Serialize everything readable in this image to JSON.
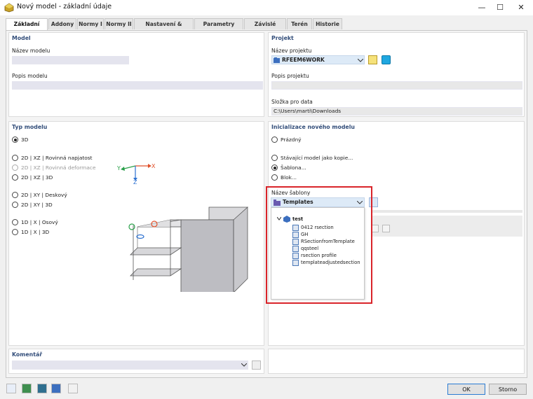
{
  "window": {
    "title": "Nový model - základní údaje",
    "minimize": "—",
    "maximize": "☐",
    "close": "✕"
  },
  "tabs": [
    "Základní údaje",
    "Addony",
    "Normy I",
    "Normy II",
    "Nastavení & možnosti",
    "Parametry modelu",
    "Závislé modely",
    "Terén",
    "Historie"
  ],
  "model": {
    "section": "Model",
    "name_label": "Název modelu",
    "name_value": "",
    "desc_label": "Popis modelu",
    "desc_value": ""
  },
  "project": {
    "section": "Projekt",
    "name_label": "Název projektu",
    "name_value": "RFEEM6WORK",
    "desc_label": "Popis projektu",
    "desc_value": "",
    "folder_label": "Složka pro data",
    "folder_value": "C:\\Users\\marti\\Downloads"
  },
  "model_type": {
    "section": "Typ modelu",
    "options": [
      "3D",
      "2D | XZ | Rovinná napjatost",
      "2D | XZ | Rovinná deformace",
      "2D | XZ | 3D",
      "2D | XY | Deskový",
      "2D | XY | 3D",
      "1D | X | Osový",
      "1D | X | 3D"
    ],
    "selected": "3D",
    "disabled": [
      "2D | XZ | Rovinná deformace"
    ],
    "axes": {
      "x": "X",
      "y": "Y",
      "z": "Z"
    }
  },
  "init": {
    "section": "Inicializace nového modelu",
    "options": [
      "Prázdný",
      "Stávající model jako kopie...",
      "Šablona...",
      "Blok..."
    ],
    "selected": "Šablona...",
    "template_label": "Název šablony",
    "template_value": "Templates",
    "tree_root": "test",
    "tree_items": [
      "0412 rsection",
      "GH",
      "RSectionfromTemplate",
      "qqsteel",
      "rsection profile",
      "templateadjustedsection"
    ]
  },
  "comment": {
    "section": "Komentář",
    "value": ""
  },
  "buttons": {
    "ok": "OK",
    "cancel": "Storno"
  },
  "colors": {
    "accent": "#2b7cd3",
    "section_title": "#334e7a",
    "highlight": "#d9242a"
  }
}
